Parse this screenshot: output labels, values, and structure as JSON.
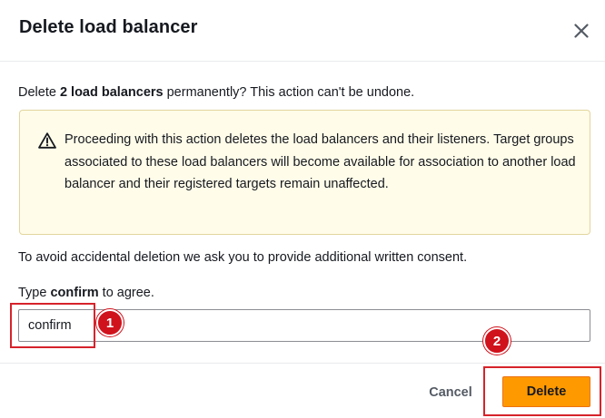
{
  "dialog": {
    "title": "Delete load balancer",
    "prompt_prefix": "Delete ",
    "prompt_bold": "2 load balancers",
    "prompt_suffix": " permanently? This action can't be undone.",
    "warning": {
      "icon": "warning-icon",
      "text": "Proceeding with this action deletes the load balancers and their listeners. Target groups associated to these load balancers will become available for association to another load balancer and their registered targets remain unaffected."
    },
    "consent_text": "To avoid accidental deletion we ask you to provide additional written consent.",
    "type_prefix": "Type ",
    "type_bold": "confirm",
    "type_suffix": " to agree.",
    "input_value": "confirm",
    "cancel_label": "Cancel",
    "delete_label": "Delete"
  },
  "annotations": {
    "badge_1": "1",
    "badge_2": "2",
    "highlight_color": "#d6232b"
  },
  "colors": {
    "primary_button": "#ff9900",
    "warning_bg": "#fffce9",
    "warning_border": "#e2d59d"
  }
}
